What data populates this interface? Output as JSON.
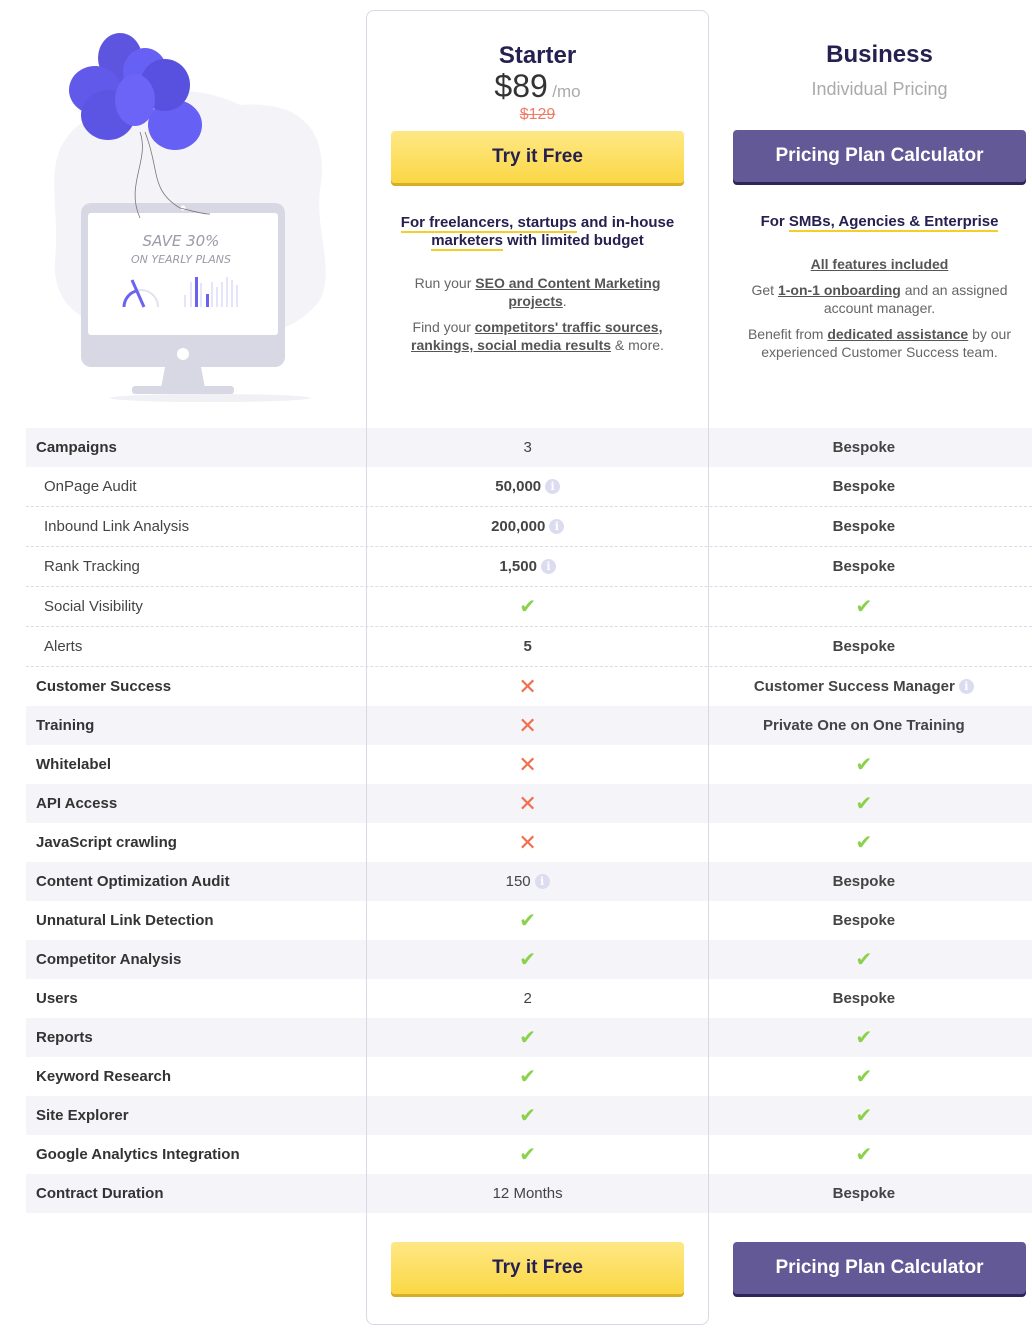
{
  "illustration": {
    "promo_line1": "SAVE 30%",
    "promo_line2": "ON YEARLY PLANS"
  },
  "plans": {
    "starter": {
      "name": "Starter",
      "price": "$89",
      "period": "/mo",
      "old_price": "$129",
      "cta_label": "Try it Free",
      "tagline_hl1": "For freelancers, startups",
      "tagline_mid": " and in-house ",
      "tagline_hl2": "marketers",
      "tagline_end": " with limited budget",
      "desc1_pre": "Run your ",
      "desc1_link": "SEO and Content Marketing projects",
      "desc1_post": ".",
      "desc2_pre": "Find your ",
      "desc2_link": "competitors' traffic sources, rankings, social media results",
      "desc2_post": " & more."
    },
    "business": {
      "name": "Business",
      "subtitle": "Individual Pricing",
      "cta_label": "Pricing Plan Calculator",
      "tagline_pre": "For ",
      "tagline_hl": "SMBs, Agencies & Enterprise",
      "desc0_link": "All features included",
      "desc1_pre": "Get ",
      "desc1_link": "1-on-1 onboarding",
      "desc1_post": " and an assigned account manager.",
      "desc2_pre": "Benefit from ",
      "desc2_link": "dedicated assistance",
      "desc2_post": " by our experienced Customer Success team."
    }
  },
  "features": [
    {
      "label": "Campaigns",
      "type": "main",
      "starter": "3",
      "starter_plain": true,
      "business": "Bespoke"
    },
    {
      "label": "OnPage Audit",
      "type": "sub",
      "starter": "50,000",
      "starter_info": true,
      "business": "Bespoke"
    },
    {
      "label": "Inbound Link Analysis",
      "type": "sub",
      "starter": "200,000",
      "starter_info": true,
      "business": "Bespoke"
    },
    {
      "label": "Rank Tracking",
      "type": "sub",
      "starter": "1,500",
      "starter_info": true,
      "business": "Bespoke"
    },
    {
      "label": "Social Visibility",
      "type": "sub",
      "starter": "check",
      "business": "check"
    },
    {
      "label": "Alerts",
      "type": "sub",
      "starter": "5",
      "business": "Bespoke"
    },
    {
      "label": "Customer Success",
      "type": "main",
      "starter": "cross",
      "business": "Customer Success Manager",
      "business_info": true
    },
    {
      "label": "Training",
      "type": "main",
      "starter": "cross",
      "business": "Private One on One Training"
    },
    {
      "label": "Whitelabel",
      "type": "main",
      "starter": "cross",
      "business": "check"
    },
    {
      "label": "API Access",
      "type": "main",
      "starter": "cross",
      "business": "check"
    },
    {
      "label": "JavaScript crawling",
      "type": "main",
      "starter": "cross",
      "business": "check"
    },
    {
      "label": "Content Optimization Audit",
      "type": "main",
      "starter": "150",
      "starter_plain": true,
      "starter_info": true,
      "business": "Bespoke"
    },
    {
      "label": "Unnatural Link Detection",
      "type": "main",
      "starter": "check",
      "business": "Bespoke"
    },
    {
      "label": "Competitor Analysis",
      "type": "main",
      "starter": "check",
      "business": "check"
    },
    {
      "label": "Users",
      "type": "main",
      "starter": "2",
      "starter_plain": true,
      "business": "Bespoke"
    },
    {
      "label": "Reports",
      "type": "main",
      "starter": "check",
      "business": "check"
    },
    {
      "label": "Keyword Research",
      "type": "main",
      "starter": "check",
      "business": "check"
    },
    {
      "label": "Site Explorer",
      "type": "main",
      "starter": "check",
      "business": "check"
    },
    {
      "label": "Google Analytics Integration",
      "type": "main",
      "starter": "check",
      "business": "check"
    },
    {
      "label": "Contract Duration",
      "type": "main",
      "starter": "12 Months",
      "starter_plain": true,
      "business": "Bespoke"
    }
  ],
  "icons": {
    "check": "✔",
    "cross": "✕",
    "info": "i"
  },
  "colors": {
    "brand_dark": "#25204f",
    "cta_yellow": "#fbd745",
    "cta_purple": "#635997",
    "check_green": "#8bd14b",
    "cross_red": "#f06f4c",
    "old_price": "#f07c66"
  }
}
